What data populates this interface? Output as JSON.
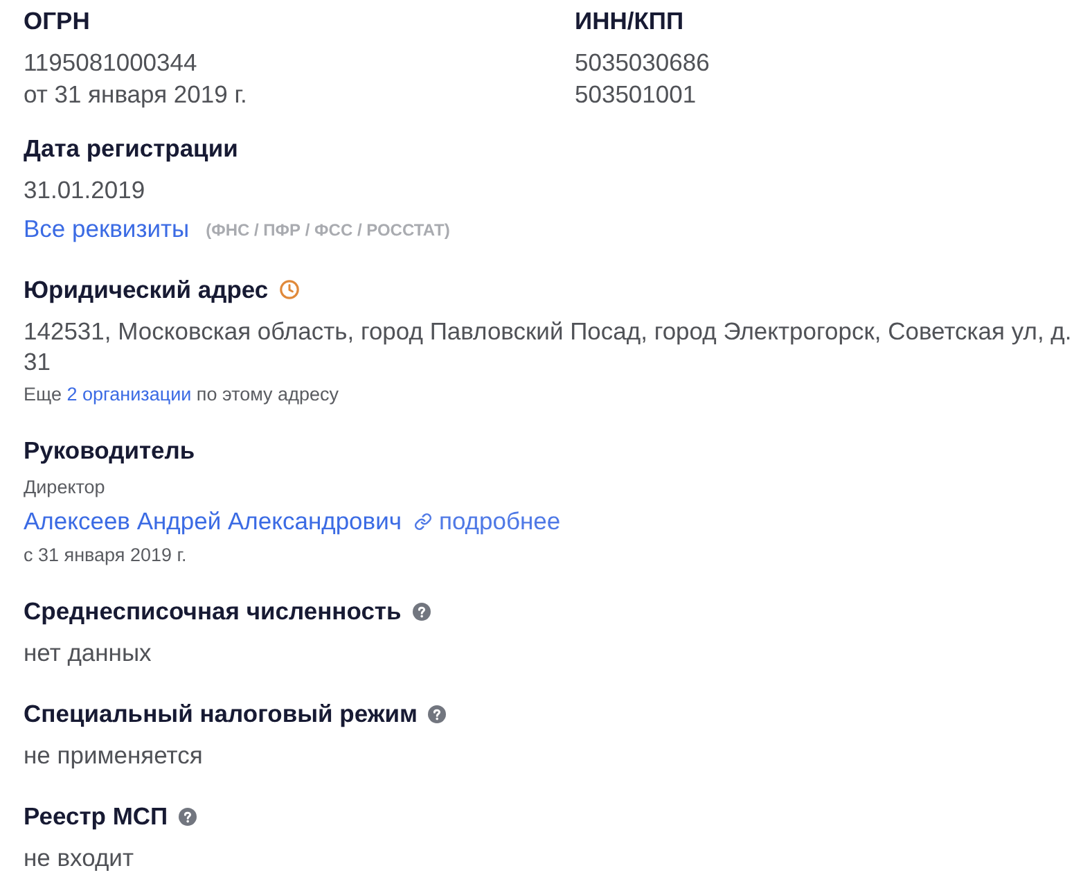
{
  "top_fields": [
    {
      "label": "ОГРН",
      "lines": [
        "1195081000344",
        "от 31 января 2019 г."
      ]
    },
    {
      "label": "ИНН/КПП",
      "lines": [
        "5035030686",
        "503501001"
      ]
    }
  ],
  "sections": [
    {
      "kind": "date",
      "label": "Дата регистрации",
      "help": false,
      "value": "31.01.2019",
      "link": "Все реквизиты",
      "link_note": "(ФНС / ПФР / ФСС / РОССТАТ)"
    },
    {
      "kind": "address",
      "label": "Юридический адрес",
      "help": false,
      "value": "142531, Московская область, город Павловский Посад, город Электрогорск, Советская ул, д. 31",
      "note_prefix": "Еще",
      "note_link": "2 организации",
      "note_suffix": "по этому адресу"
    },
    {
      "kind": "person",
      "label": "Руководитель",
      "help": false,
      "role": "Директор",
      "name": "Алексеев Андрей Александрович",
      "details_link": "подробнее",
      "since": "с 31 января 2019 г."
    },
    {
      "kind": "plain",
      "label": "Среднесписочная численность",
      "help": true,
      "value": "нет данных"
    },
    {
      "kind": "plain",
      "label": "Специальный налоговый режим",
      "help": true,
      "value": "не применяется"
    },
    {
      "kind": "plain",
      "label": "Реестр МСП",
      "help": true,
      "value": "не входит"
    }
  ]
}
